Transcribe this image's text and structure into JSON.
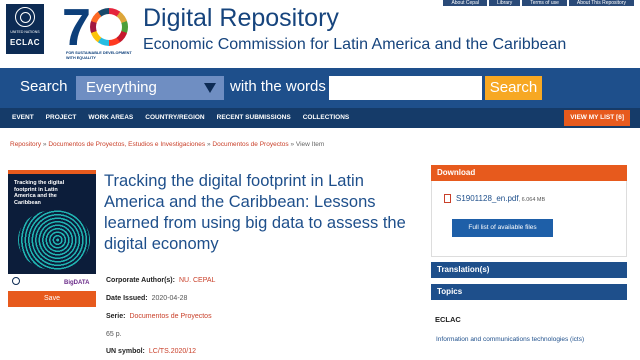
{
  "toplinks": [
    "About Cepal",
    "Library",
    "Terms of use",
    "About This Repository"
  ],
  "header": {
    "un_text": "UNITED NATIONS",
    "eclac_logo": "ECLAC",
    "anniversary_sub": "FOR SUSTAINABLE DEVELOPMENT WITH EQUALITY",
    "title": "Digital Repository",
    "subtitle": "Economic Commission for Latin America and the Caribbean"
  },
  "search": {
    "label": "Search",
    "scope": "Everything",
    "with_label": "with the words",
    "query": "",
    "button": "Search"
  },
  "nav": {
    "items": [
      "EVENT",
      "PROJECT",
      "WORK AREAS",
      "COUNTRY/REGION",
      "RECENT SUBMISSIONS",
      "COLLECTIONS"
    ],
    "my_list": "VIEW MY LIST [6]"
  },
  "breadcrumb": {
    "items": [
      "Repository",
      "Documentos de Proyectos, Estudios e Investigaciones",
      "Documentos de Proyectos"
    ],
    "sep": "»",
    "current": "View Item"
  },
  "cover": {
    "title": "Tracking the digital footprint in Latin America and the Caribbean",
    "brand": "BigDATA"
  },
  "save_button": "Save",
  "item": {
    "title": "Tracking the digital footprint in Latin America and the Caribbean: Lessons learned from using big data to assess the digital economy"
  },
  "meta": {
    "corporate_author_label": "Corporate Author(s):",
    "corporate_author": "NU. CEPAL",
    "date_label": "Date Issued:",
    "date": "2020-04-28",
    "serie_label": "Serie:",
    "serie": "Documentos de Proyectos",
    "pages": "65 p.",
    "un_symbol_label": "UN symbol:",
    "un_symbol": "LC/TS.2020/12"
  },
  "download": {
    "heading": "Download",
    "file_name": "S1901128_en.pdf",
    "file_size": ", 6.064 MB",
    "full_list_button": "Full list of available files"
  },
  "translation": {
    "heading": "Translation(s)"
  },
  "topics": {
    "heading": "Topics",
    "group": "ECLAC",
    "item": "Information and communications technologies (icts)"
  }
}
